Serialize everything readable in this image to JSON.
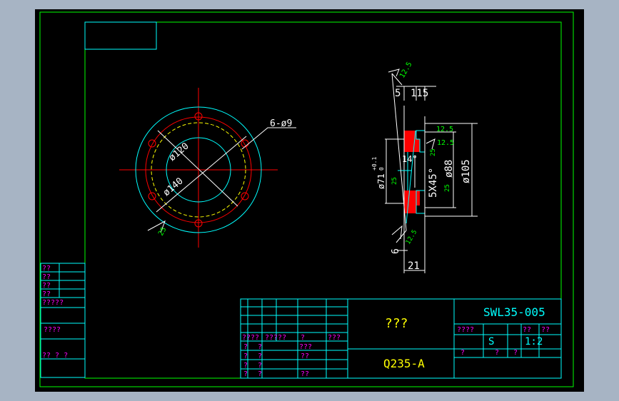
{
  "drawing": {
    "views": {
      "front": {
        "bolt_holes_label": "6-ø9",
        "pitch_diameter_label": "ø120",
        "bore_diameter_label": "ø140",
        "roughness_label": "25"
      },
      "section": {
        "roughness_top": "12.5",
        "roughness_right": "12.5",
        "roughness_mid": "12.5",
        "roughness_a": "25",
        "roughness_b": "25",
        "roughness_c": "25",
        "roughness_bottom": "12.5",
        "dim_5": "5",
        "dim_115": "115",
        "dim_14": "14",
        "angle_14": "14°",
        "chamfer": "5X45°",
        "dia_88": "ø88",
        "dia_105": "ø105",
        "dia_71": "ø71",
        "tol_upper": "+0.1",
        "tol_lower": "0",
        "dim_6": "6",
        "dim_21": "21"
      }
    },
    "title_block": {
      "drawing_number": "SWL35-005",
      "part_name": "???",
      "material": "Q235-A",
      "scale": "1:2",
      "scale_label": "??",
      "mark_s": "S",
      "weight_label": "??",
      "stage_label": "????",
      "sheet_left": "?",
      "sheet_mid": "?",
      "sheet_right": "?",
      "header_cells": [
        "????",
        "?????",
        "?",
        "???"
      ],
      "sign_rows": [
        [
          "?",
          "?",
          "???"
        ],
        [
          "?",
          "?",
          "??"
        ],
        [
          "?",
          "?",
          ""
        ],
        [
          "?",
          "?",
          "??"
        ]
      ]
    },
    "side_block": [
      "??",
      "??",
      "??",
      "??",
      "?????",
      "????",
      "?? ? ?"
    ]
  }
}
